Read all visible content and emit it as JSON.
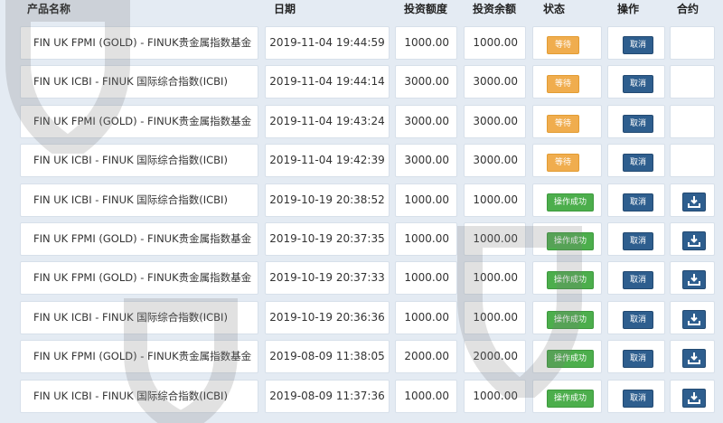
{
  "header": {
    "product": "产品名称",
    "date": "日期",
    "amount": "投资额度",
    "balance": "投资余额",
    "status": "状态",
    "operation": "操作",
    "contract": "合约"
  },
  "rows": [
    {
      "name": "FIN UK FPMI (GOLD) - FINUK贵金属指数基金",
      "date": "2019-11-04 19:44:59",
      "amount": "1000.00",
      "balance": "1000.00",
      "status": "等待",
      "status_type": "wait",
      "cancel": "取消",
      "download": false
    },
    {
      "name": "FIN UK ICBI - FINUK 国际综合指数(ICBI)",
      "date": "2019-11-04 19:44:14",
      "amount": "3000.00",
      "balance": "3000.00",
      "status": "等待",
      "status_type": "wait",
      "cancel": "取消",
      "download": false
    },
    {
      "name": "FIN UK FPMI (GOLD) - FINUK贵金属指数基金",
      "date": "2019-11-04 19:43:24",
      "amount": "3000.00",
      "balance": "3000.00",
      "status": "等待",
      "status_type": "wait",
      "cancel": "取消",
      "download": false
    },
    {
      "name": "FIN UK ICBI - FINUK 国际综合指数(ICBI)",
      "date": "2019-11-04 19:42:39",
      "amount": "3000.00",
      "balance": "3000.00",
      "status": "等待",
      "status_type": "wait",
      "cancel": "取消",
      "download": false
    },
    {
      "name": "FIN UK ICBI - FINUK 国际综合指数(ICBI)",
      "date": "2019-10-19 20:38:52",
      "amount": "1000.00",
      "balance": "1000.00",
      "status": "操作成功",
      "status_type": "ok",
      "cancel": "取消",
      "download": true
    },
    {
      "name": "FIN UK FPMI (GOLD) - FINUK贵金属指数基金",
      "date": "2019-10-19 20:37:35",
      "amount": "1000.00",
      "balance": "1000.00",
      "status": "操作成功",
      "status_type": "ok",
      "cancel": "取消",
      "download": true
    },
    {
      "name": "FIN UK FPMI (GOLD) - FINUK贵金属指数基金",
      "date": "2019-10-19 20:37:33",
      "amount": "1000.00",
      "balance": "1000.00",
      "status": "操作成功",
      "status_type": "ok",
      "cancel": "取消",
      "download": true
    },
    {
      "name": "FIN UK ICBI - FINUK 国际综合指数(ICBI)",
      "date": "2019-10-19 20:36:36",
      "amount": "1000.00",
      "balance": "1000.00",
      "status": "操作成功",
      "status_type": "ok",
      "cancel": "取消",
      "download": true
    },
    {
      "name": "FIN UK FPMI (GOLD) - FINUK贵金属指数基金",
      "date": "2019-08-09 11:38:05",
      "amount": "2000.00",
      "balance": "2000.00",
      "status": "操作成功",
      "status_type": "ok",
      "cancel": "取消",
      "download": true
    },
    {
      "name": "FIN UK ICBI - FINUK 国际综合指数(ICBI)",
      "date": "2019-08-09 11:37:36",
      "amount": "1000.00",
      "balance": "1000.00",
      "status": "操作成功",
      "status_type": "ok",
      "cancel": "取消",
      "download": true
    }
  ],
  "colors": {
    "wait": "#f0ad4e",
    "ok": "#4cae4c",
    "button": "#2e5e8e"
  },
  "icons": {
    "download": "download-icon",
    "watermark": "shield-watermark-icon"
  }
}
